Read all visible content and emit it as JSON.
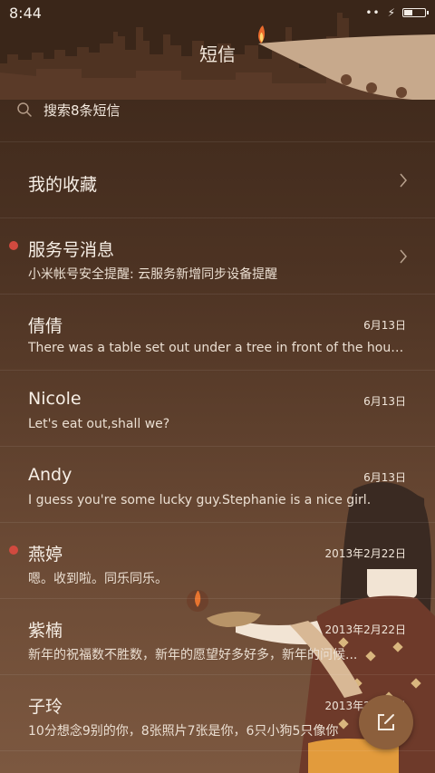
{
  "status_bar": {
    "time": "8:44",
    "battery_level": 0.4
  },
  "header": {
    "title": "短信"
  },
  "search": {
    "placeholder": "搜索8条短信"
  },
  "conversations": [
    {
      "name": "我的收藏",
      "preview": "",
      "date": "",
      "unread": false,
      "has_chevron": true
    },
    {
      "name": "服务号消息",
      "preview": "小米帐号安全提醒: 云服务新增同步设备提醒",
      "date": "",
      "unread": true,
      "has_chevron": true
    },
    {
      "name": "倩倩",
      "preview": "There was a table set out under a tree in front of the house...",
      "date": "6月13日",
      "unread": false,
      "has_chevron": false
    },
    {
      "name": "Nicole",
      "preview": "Let's eat out,shall we?",
      "date": "6月13日",
      "unread": false,
      "has_chevron": false
    },
    {
      "name": "Andy",
      "preview": "I guess you're some lucky guy.Stephanie is a nice girl.",
      "date": "6月13日",
      "unread": false,
      "has_chevron": false
    },
    {
      "name": "燕婷",
      "preview": "嗯。收到啦。同乐同乐。",
      "date": "2013年2月22日",
      "unread": true,
      "has_chevron": false
    },
    {
      "name": "紫楠",
      "preview": "新年的祝福数不胜数，新年的愿望好多好多，新年的问候...",
      "date": "2013年2月22日",
      "unread": false,
      "has_chevron": false
    },
    {
      "name": "子玲",
      "preview": "10分想念9别的你，8张照片7张是你，6只小狗5只像你",
      "date": "2013年2月22日",
      "unread": false,
      "has_chevron": false
    }
  ],
  "icons": {
    "search": "search-icon",
    "chevron": "chevron-right-icon",
    "compose": "compose-icon",
    "flash": "charging-icon"
  },
  "colors": {
    "unread_dot": "#d14a3f",
    "fab": "#8c5f3c"
  }
}
